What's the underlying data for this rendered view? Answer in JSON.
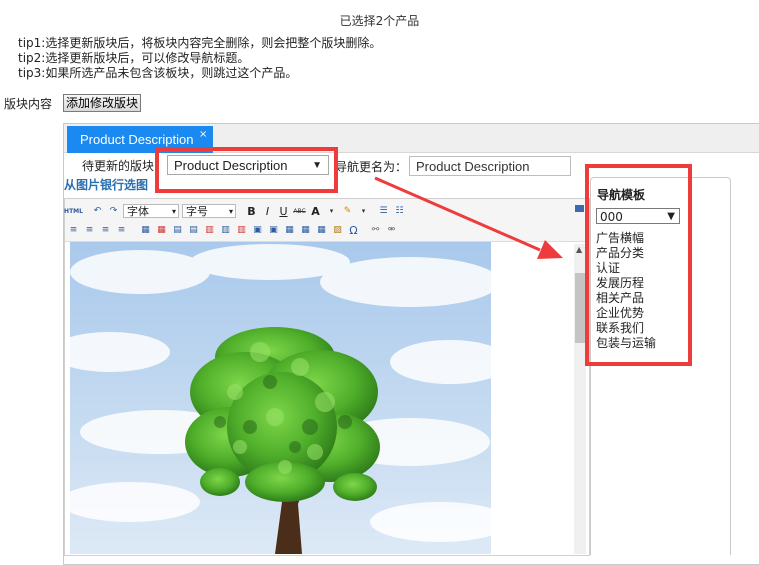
{
  "header": {
    "title": "已选择2个产品"
  },
  "tips": [
    "tip1:选择更新版块后，将板块内容完全删除，则会把整个版块删除。",
    "tip2:选择更新版块后，可以修改导航标题。",
    "tip3:如果所选产品未包含该板块，则跳过这个产品。"
  ],
  "content_section": {
    "label": "版块内容",
    "add_button": "添加修改版块"
  },
  "tab": {
    "label": "Product Description",
    "close": "×"
  },
  "form": {
    "update_label": "待更新的版块",
    "update_select_value": "Product Description",
    "rename_label": "导航更名为：",
    "rename_value": "Product Description",
    "image_bank_link": "从图片银行选图"
  },
  "editor_toolbar": {
    "font_label": "字体",
    "size_label": "字号",
    "bold": "B",
    "italic": "I",
    "underline": "U",
    "strike": "ABC",
    "font_color": "A",
    "special_char": "Ω",
    "html_label": "HTML"
  },
  "nav_panel": {
    "title": "导航模板",
    "select_value": "000",
    "items": [
      "广告横幅",
      "产品分类",
      "认证",
      "发展历程",
      "相关产品",
      "企业优势",
      "联系我们",
      "包装与运输"
    ]
  },
  "colors": {
    "tab_blue": "#1a8af0",
    "annotation_red": "#ee3b3b",
    "link_blue": "#2a6fb0"
  }
}
